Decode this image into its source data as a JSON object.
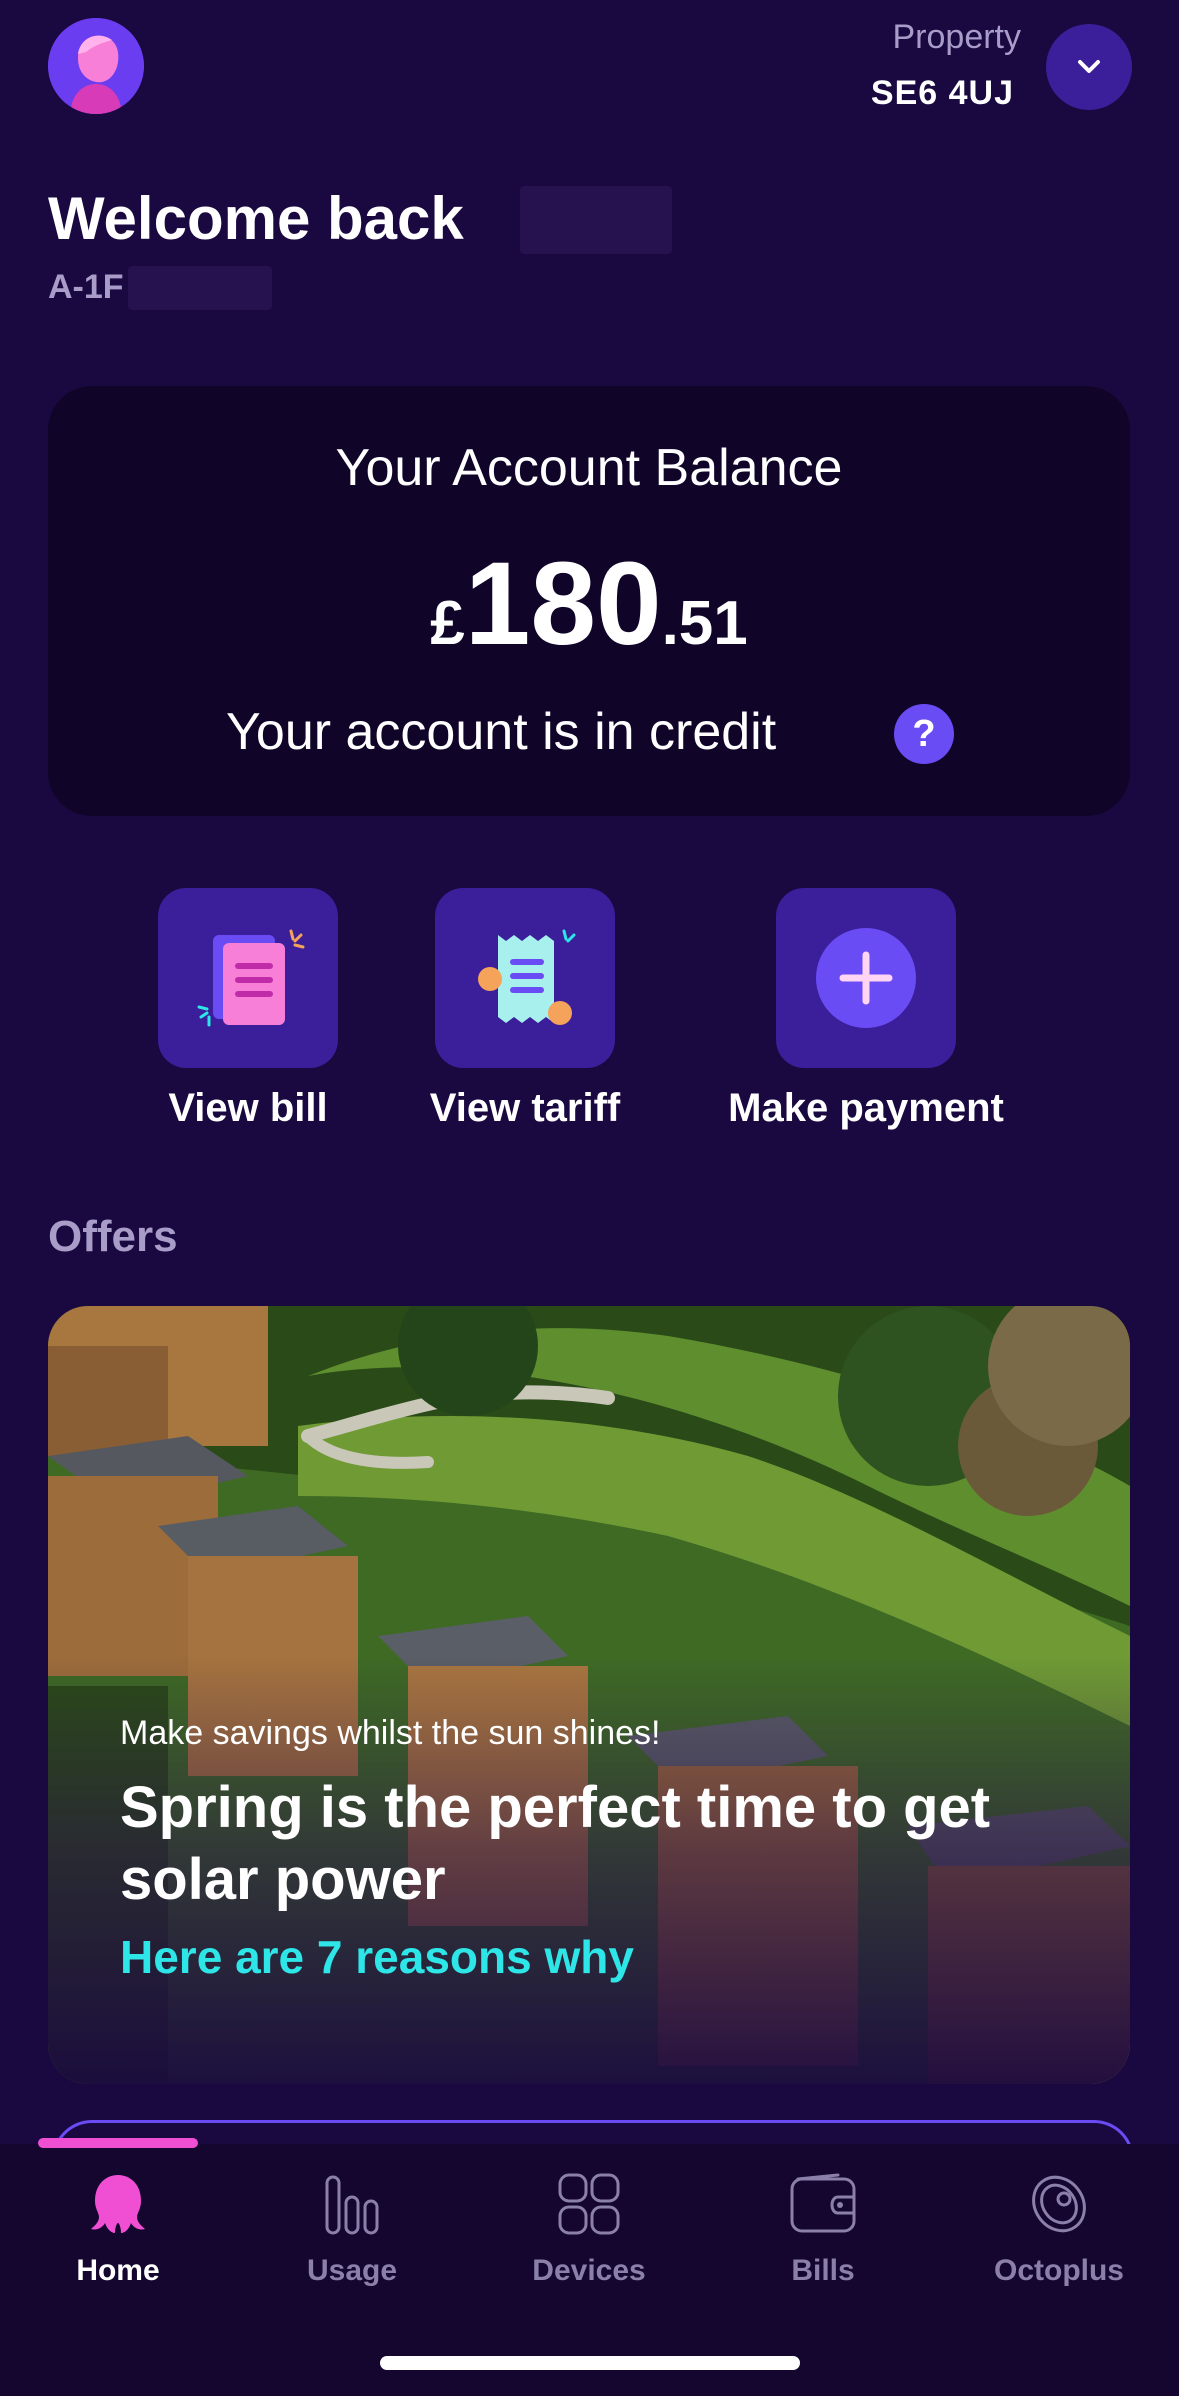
{
  "header": {
    "avatar_icon": "user-avatar-icon",
    "property_label": "Property",
    "property_value": "SE6 4UJ",
    "toggle_icon": "chevron-down-icon"
  },
  "welcome": {
    "greeting": "Welcome back",
    "account_prefix": "A-1F"
  },
  "balance": {
    "title": "Your Account Balance",
    "currency": "£",
    "whole": "180",
    "decimal": ".51",
    "status": "Your account is in credit",
    "help_label": "?"
  },
  "quick_actions": [
    {
      "label": "View bill",
      "icon": "bill-document-icon"
    },
    {
      "label": "View tariff",
      "icon": "tariff-receipt-icon"
    },
    {
      "label": "Make payment",
      "icon": "plus-icon"
    }
  ],
  "offers": {
    "section_title": "Offers",
    "kicker": "Make savings whilst the sun shines!",
    "title": "Spring is the perfect time to get solar power",
    "link": "Here are 7 reasons why"
  },
  "nav": {
    "active": "Home",
    "items": [
      {
        "label": "Home",
        "icon": "octopus-icon"
      },
      {
        "label": "Usage",
        "icon": "bar-chart-icon"
      },
      {
        "label": "Devices",
        "icon": "grid-icon"
      },
      {
        "label": "Bills",
        "icon": "wallet-icon"
      },
      {
        "label": "Octoplus",
        "icon": "octoplus-ring-icon"
      }
    ]
  },
  "colors": {
    "background": "#1a0840",
    "card": "#100428",
    "accent_purple": "#6a4cf5",
    "accent_pink": "#f04fd4",
    "accent_cyan": "#2ee5e8"
  }
}
